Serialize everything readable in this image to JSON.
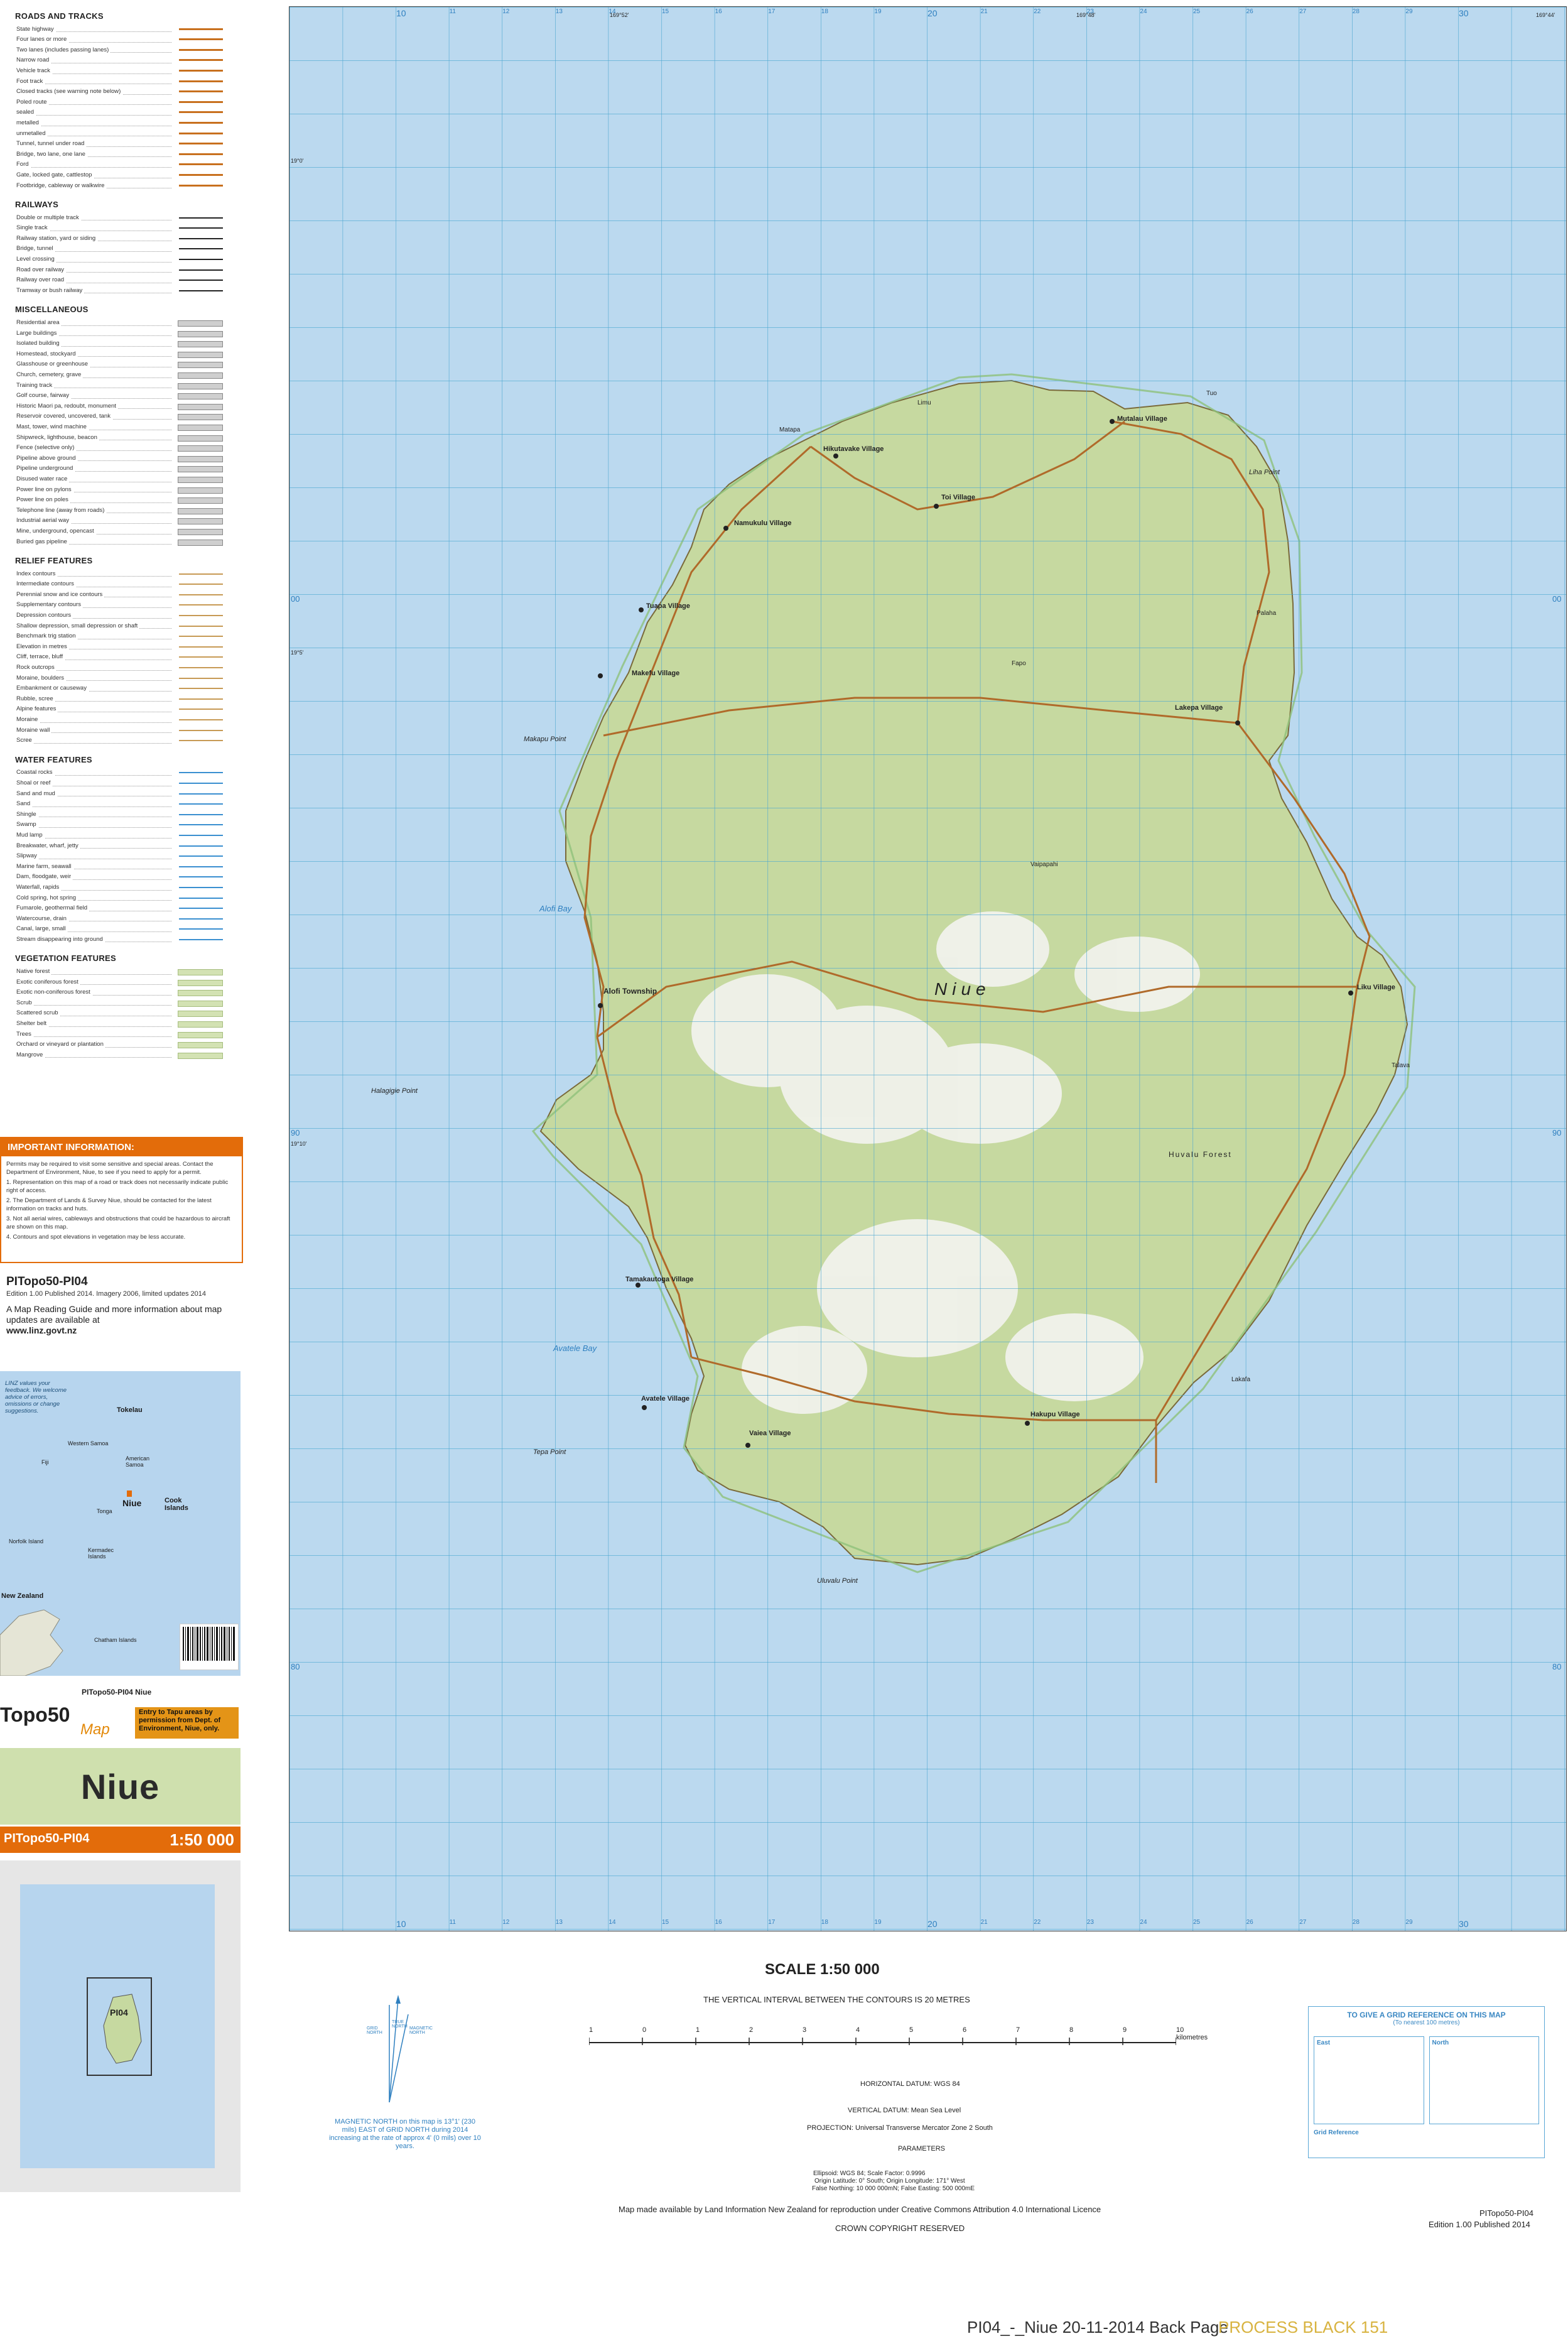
{
  "legend": {
    "roads": {
      "title": "ROADS AND TRACKS",
      "items": [
        "State highway",
        "Four lanes or more",
        "Two lanes (includes passing lanes)",
        "Narrow road",
        "Vehicle track",
        "Foot track",
        "Closed tracks (see warning note below)",
        "Poled route",
        "sealed",
        "metalled",
        "unmetalled",
        "Tunnel, tunnel under road",
        "Bridge, two lane, one lane",
        "Ford",
        "Gate, locked gate, cattlestop",
        "Footbridge, cableway or walkwire"
      ]
    },
    "railways": {
      "title": "RAILWAYS",
      "items": [
        "Double or multiple track",
        "Single track",
        "Railway station, yard or siding",
        "Bridge, tunnel",
        "Level crossing",
        "Road over railway",
        "Railway over road",
        "Tramway or bush railway"
      ]
    },
    "misc": {
      "title": "MISCELLANEOUS",
      "items": [
        "Residential area",
        "Large buildings",
        "Isolated building",
        "Homestead, stockyard",
        "Glasshouse or greenhouse",
        "Church, cemetery, grave",
        "Training track",
        "Golf course, fairway",
        "Historic Maori pa, redoubt, monument",
        "Reservoir covered, uncovered, tank",
        "Mast, tower, wind machine",
        "Shipwreck, lighthouse, beacon",
        "Fence (selective only)",
        "Pipeline above ground",
        "Pipeline underground",
        "Disused water race",
        "Power line on pylons",
        "Power line on poles",
        "Telephone line (away from roads)",
        "Industrial aerial way",
        "Mine, underground, opencast",
        "Buried gas pipeline"
      ]
    },
    "relief": {
      "title": "RELIEF FEATURES",
      "items": [
        "Index contours",
        "Intermediate contours",
        "Perennial snow and ice contours",
        "Supplementary contours",
        "Depression contours",
        "Shallow depression, small depression or shaft",
        "Benchmark trig station",
        "Elevation in metres",
        "Cliff, terrace, bluff",
        "Rock outcrops",
        "Moraine, boulders",
        "Embankment or causeway",
        "Rubble, scree",
        "Alpine features",
        "Moraine",
        "Moraine wall",
        "Scree"
      ]
    },
    "water": {
      "title": "WATER FEATURES",
      "items": [
        "Coastal rocks",
        "Shoal or reef",
        "Sand and mud",
        "Sand",
        "Shingle",
        "Swamp",
        "Mud lamp",
        "Breakwater, wharf, jetty",
        "Slipway",
        "Marine farm, seawall",
        "Dam, floodgate, weir",
        "Waterfall, rapids",
        "Cold spring, hot spring",
        "Fumarole, geothermal field",
        "Watercourse, drain",
        "Canal, large, small",
        "Stream disappearing into ground"
      ]
    },
    "vegetation": {
      "title": "VEGETATION FEATURES",
      "items": [
        "Native forest",
        "Exotic coniferous forest",
        "Exotic non-coniferous forest",
        "Scrub",
        "Scattered scrub",
        "Shelter belt",
        "Trees",
        "Orchard or vineyard or plantation",
        "Mangrove"
      ]
    }
  },
  "important": {
    "title": "IMPORTANT INFORMATION:",
    "lines": [
      "Permits may be required to visit some sensitive and special areas. Contact the Department of Environment, Niue, to see if you need to apply for a permit.",
      "1. Representation on this map of a road or track does not necessarily indicate public right of access.",
      "2. The Department of Lands & Survey Niue, should be contacted for the latest information on tracks and huts.",
      "3. Not all aerial wires, cableways and obstructions that could be hazardous to aircraft are shown on this map.",
      "4. Contours and spot elevations in vegetation may be less accurate."
    ]
  },
  "product": {
    "code": "PITopo50-PI04",
    "edition": "Edition 1.00 Published 2014. Imagery 2006, limited updates 2014",
    "guide": "A Map Reading Guide and more information about map updates are available at",
    "website": "www.linz.govt.nz"
  },
  "index_map": {
    "feedback": "LINZ values your feedback. We welcome advice of errors, omissions or change suggestions.",
    "labels": [
      "Tokelau",
      "Western Samoa",
      "American Samoa",
      "Fiji",
      "Niue",
      "Tonga",
      "Cook Islands",
      "Norfolk Island",
      "Kermadec Islands",
      "New Zealand",
      "Chatham Islands"
    ]
  },
  "brand": {
    "sheet_small": "PITopo50-PI04 Niue",
    "topo": "Topo50",
    "map_word": "Map",
    "permit": "Entry to Tapu areas by permission from Dept. of Environment, Niue, only.",
    "title": "Niue",
    "code": "PITopo50-PI04",
    "scale": "1:50 000",
    "locator_label": "PI04"
  },
  "map": {
    "island_name": "Niue",
    "villages": [
      "Mutalau Village",
      "Hikutavake Village",
      "Toi Village",
      "Namukulu Village",
      "Tuapa Village",
      "Makefu Village",
      "Lakepa Village",
      "Alofi Township",
      "Liku Village",
      "Tamakautoga Village",
      "Avatele Village",
      "Vaiea Village",
      "Hakupu Village"
    ],
    "places": [
      "Liha Point",
      "Makapu Point",
      "Alofi Bay",
      "Halagigie Point",
      "Avatele Bay",
      "Tepa Point",
      "Matapa",
      "Uluvalu Point",
      "Huvalu Forest",
      "Tuo",
      "Limu",
      "Lakafa",
      "Talava",
      "Vaipapahi",
      "Palaha",
      "Fapo"
    ],
    "grid_top": [
      "10",
      "11",
      "12",
      "13",
      "14",
      "15",
      "16",
      "17",
      "18",
      "19",
      "20",
      "21",
      "22",
      "23",
      "24",
      "25",
      "26",
      "27",
      "28",
      "29",
      "30"
    ],
    "grid_left": [
      "00",
      "90",
      "80"
    ],
    "lon_labels": [
      "169°52'",
      "169°48'",
      "169°44'"
    ],
    "lat_labels": [
      "19°0'",
      "19°5'",
      "19°10'"
    ]
  },
  "bottom": {
    "scale_title": "SCALE 1:50 000",
    "contour_note": "THE VERTICAL INTERVAL BETWEEN THE CONTOURS IS 20 METRES",
    "scale_ticks": [
      "1",
      "0",
      "1",
      "2",
      "3",
      "4",
      "5",
      "6",
      "7",
      "8",
      "9",
      "10 kilometres"
    ],
    "horiz_datum": "HORIZONTAL DATUM: WGS 84",
    "vert_datum": "VERTICAL DATUM: Mean Sea Level",
    "projection": "PROJECTION: Universal Transverse Mercator Zone 2 South",
    "params_head": "PARAMETERS",
    "ellipsoid": "Ellipsoid: WGS 84; Scale Factor: 0.9996",
    "origin": "Origin Latitude: 0° South; Origin Longitude: 171° West",
    "false_n": "False Northing: 10 000 000mN; False Easting: 500 000mE",
    "cc": "Map made available by Land Information New Zealand for reproduction under Creative Commons Attribution 4.0 International Licence",
    "crown": "CROWN COPYRIGHT RESERVED",
    "edition_code": "PITopo50-PI04",
    "edition_text": "Edition 1.00 Published 2014",
    "mag_note": "MAGNETIC NORTH on this map is 13°1' (230 mils) EAST of GRID NORTH during 2014 increasing at the rate of approx 4' (0 mils) over 10 years.",
    "north_labels": [
      "GRID NORTH",
      "TRUE NORTH",
      "MAGNETIC NORTH"
    ],
    "gridref_title": "TO GIVE A GRID REFERENCE ON THIS MAP",
    "gridref_sub": "(To nearest 100 metres)",
    "gridref_east": "East",
    "gridref_north": "North",
    "gridref_foot": "Grid Reference",
    "slug": "PI04_-_Niue 20-11-2014  Back Page",
    "slug2": "PROCESS BLACK 151"
  },
  "colors": {
    "sea": "#bbd9ef",
    "land": "#c6d9a0",
    "road": "#b06a2a",
    "grid": "#4aa6d0",
    "orange": "#e36c0a"
  }
}
